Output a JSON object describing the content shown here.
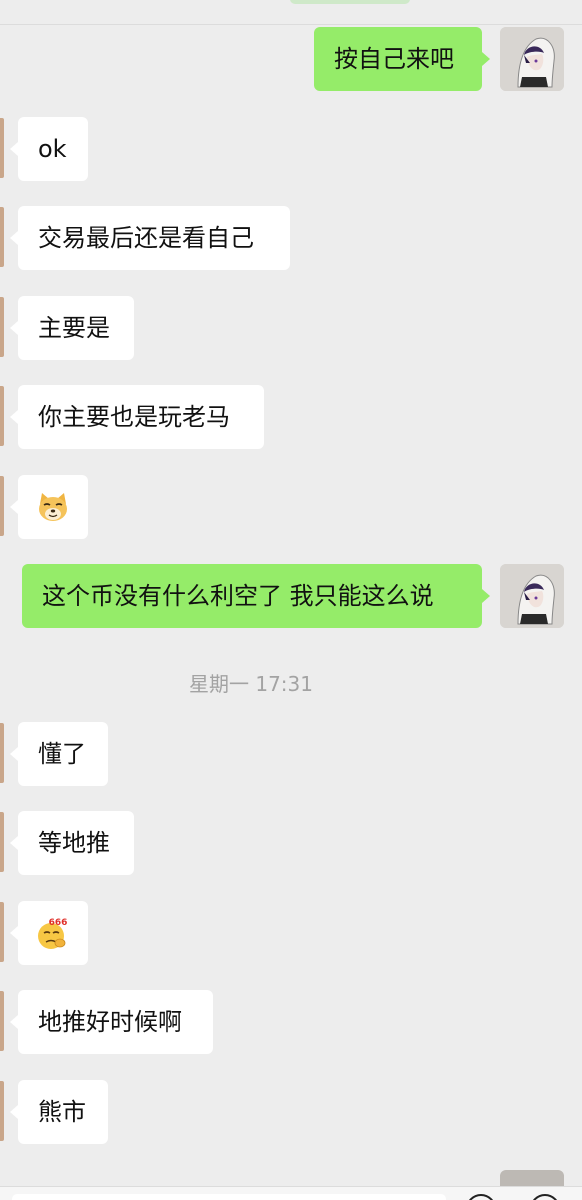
{
  "chat": {
    "timestamp": "星期一 17:31",
    "messages": [
      {
        "side": "out",
        "type": "text",
        "text": "按自己来吧"
      },
      {
        "side": "in",
        "type": "text",
        "text": "ok"
      },
      {
        "side": "in",
        "type": "text",
        "text": "交易最后还是看自己"
      },
      {
        "side": "in",
        "type": "text",
        "text": "主要是"
      },
      {
        "side": "in",
        "type": "text",
        "text": "你主要也是玩老马"
      },
      {
        "side": "in",
        "type": "emoji",
        "emoji": "doge-icon"
      },
      {
        "side": "out",
        "type": "text",
        "text": "这个币没有什么利空了 我只能这么说"
      },
      {
        "side": "in",
        "type": "text",
        "text": "懂了"
      },
      {
        "side": "in",
        "type": "text",
        "text": "等地推"
      },
      {
        "side": "in",
        "type": "emoji",
        "emoji": "666-emoji-icon",
        "emoji_label": "666"
      },
      {
        "side": "in",
        "type": "text",
        "text": "地推好时候啊"
      },
      {
        "side": "in",
        "type": "text",
        "text": "熊市"
      }
    ]
  },
  "colors": {
    "background": "#ededed",
    "outgoing_bubble": "#95ec69",
    "incoming_bubble": "#ffffff",
    "timestamp_text": "#a3a3a3"
  }
}
